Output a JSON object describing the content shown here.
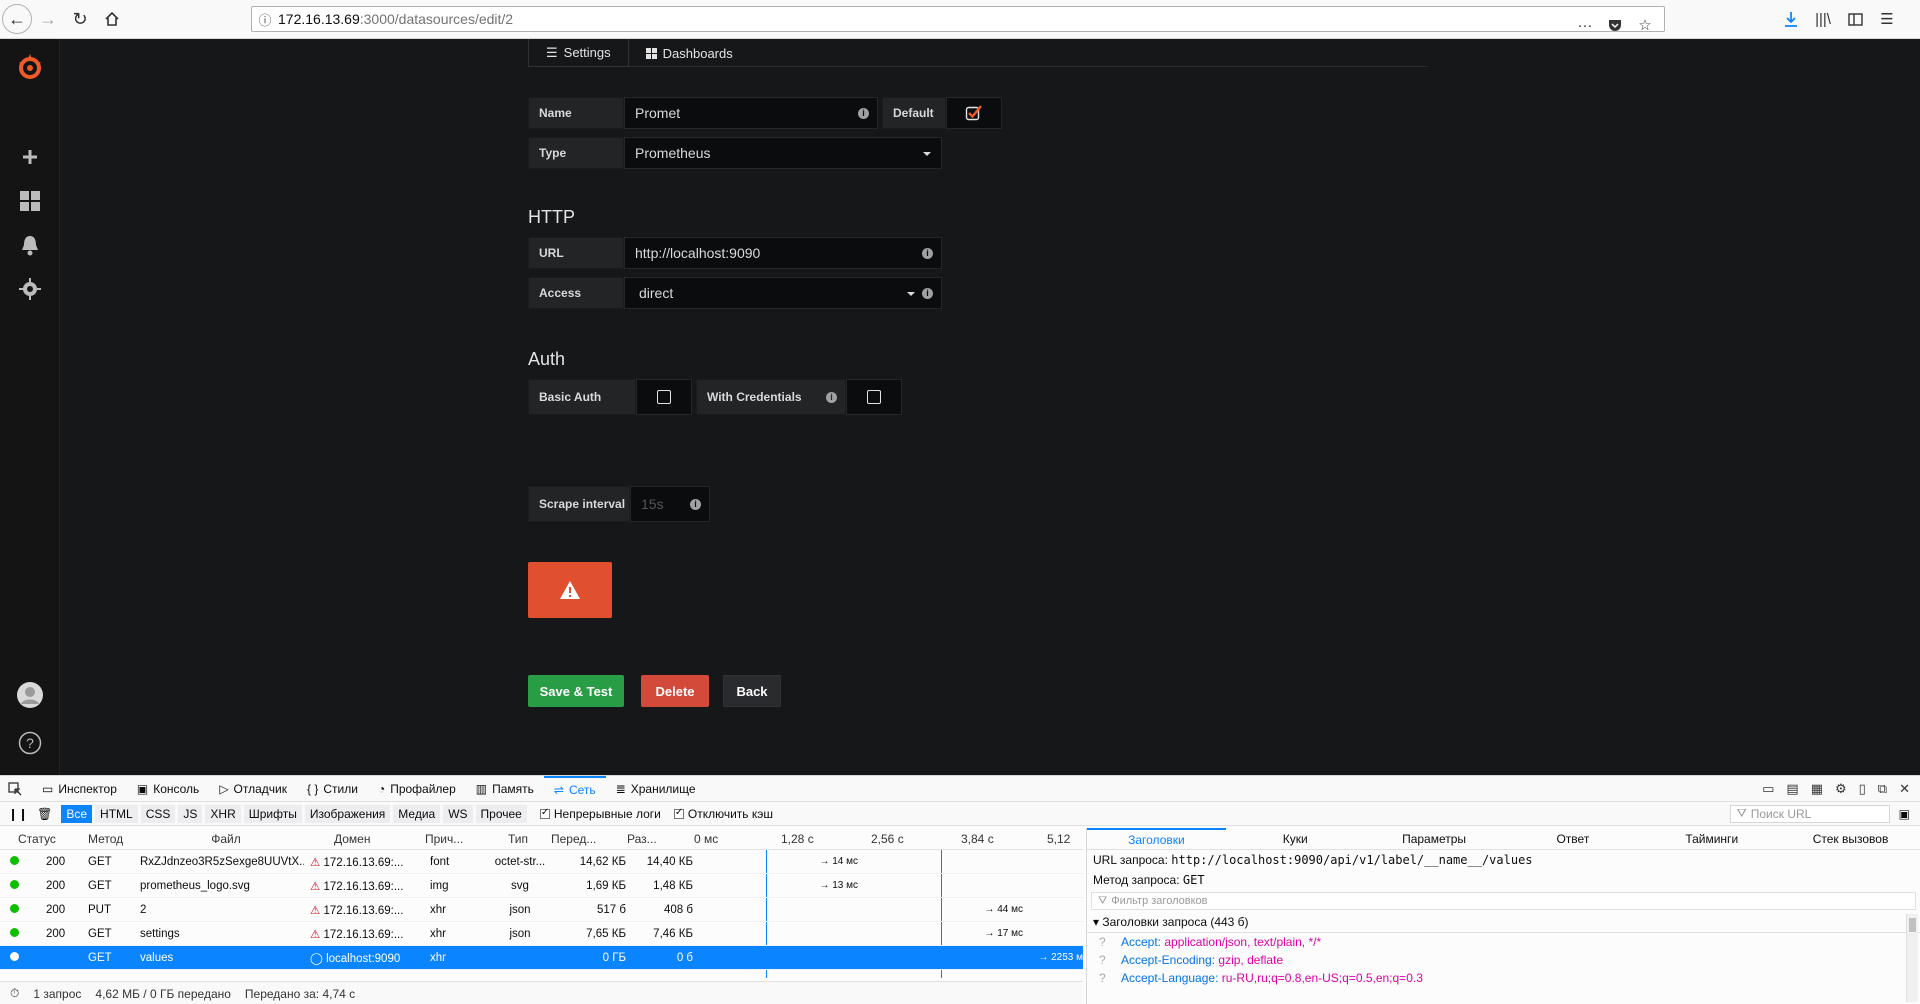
{
  "browser": {
    "url_host": "172.16.13.69",
    "url_path": ":3000/datasources/edit/2"
  },
  "tabs": [
    {
      "label": "Settings"
    },
    {
      "label": "Dashboards"
    }
  ],
  "form": {
    "name_label": "Name",
    "name_value": "Promet",
    "default_label": "Default",
    "type_label": "Type",
    "type_value": "Prometheus",
    "http_title": "HTTP",
    "url_label": "URL",
    "url_value": "http://localhost:9090",
    "access_label": "Access",
    "access_value": "direct",
    "auth_title": "Auth",
    "basic_auth_label": "Basic Auth",
    "with_credentials_label": "With Credentials",
    "scrape_label": "Scrape interval",
    "scrape_placeholder": "15s"
  },
  "buttons": {
    "save": "Save & Test",
    "delete": "Delete",
    "back": "Back"
  },
  "colors": {
    "save": "#299c46",
    "delete": "#d44a3a",
    "alert": "#e0502e",
    "grafana_orange": "#f05a28"
  },
  "devtools": {
    "tabs": [
      "Инспектор",
      "Консоль",
      "Отладчик",
      "Стили",
      "Профайлер",
      "Память",
      "Сеть",
      "Хранилище"
    ],
    "filters": [
      "Все",
      "HTML",
      "CSS",
      "JS",
      "XHR",
      "Шрифты",
      "Изображения",
      "Медиа",
      "WS",
      "Прочее"
    ],
    "persist_logs": "Непрерывные логи",
    "disable_cache": "Отключить кэш",
    "search_placeholder": "Поиск URL",
    "columns": [
      "Статус",
      "Метод",
      "Файл",
      "Домен",
      "Прич...",
      "Тип",
      "Перед...",
      "Раз...",
      "0 мс",
      "1,28 с",
      "2,56 с",
      "3,84 с",
      "5,12"
    ],
    "rows": [
      {
        "status": "200",
        "method": "GET",
        "file": "RxZJdnzeo3R5zSexge8UUVtX...",
        "domain": "172.16.13.69:...",
        "cause": "font",
        "type": "octet-str...",
        "transferred": "14,62 КБ",
        "size": "14,40 КБ",
        "timing": "→ 14 мс"
      },
      {
        "status": "200",
        "method": "GET",
        "file": "prometheus_logo.svg",
        "domain": "172.16.13.69:...",
        "cause": "img",
        "type": "svg",
        "transferred": "1,69 КБ",
        "size": "1,48 КБ",
        "timing": "→ 13 мс"
      },
      {
        "status": "200",
        "method": "PUT",
        "file": "2",
        "domain": "172.16.13.69:...",
        "cause": "xhr",
        "type": "json",
        "transferred": "517 б",
        "size": "408 б",
        "timing": "→ 44 мс"
      },
      {
        "status": "200",
        "method": "GET",
        "file": "settings",
        "domain": "172.16.13.69:...",
        "cause": "xhr",
        "type": "json",
        "transferred": "7,65 КБ",
        "size": "7,46 КБ",
        "timing": "→ 17 мс"
      },
      {
        "status": "",
        "method": "GET",
        "file": "values",
        "domain": "localhost:9090",
        "cause": "xhr",
        "type": "",
        "transferred": "0 ГБ",
        "size": "0 б",
        "timing": "→ 2253 м"
      }
    ],
    "status_requests": "1 запрос",
    "status_size": "4,62 МБ / 0 ГБ передано",
    "status_time": "Передано за: 4,74 с",
    "side_tabs": [
      "Заголовки",
      "Куки",
      "Параметры",
      "Ответ",
      "Тайминги",
      "Стек вызовов"
    ],
    "request_url_label": "URL запроса:",
    "request_url": "http://localhost:9090/api/v1/label/__name__/values",
    "method_label": "Метод запроса:",
    "method_value": "GET",
    "header_filter_placeholder": "Фильтр заголовков",
    "request_headers_title": "Заголовки запроса (443 б)",
    "headers": [
      {
        "key": "Accept:",
        "value": "application/json, text/plain, */*"
      },
      {
        "key": "Accept-Encoding:",
        "value": "gzip, deflate"
      },
      {
        "key": "Accept-Language:",
        "value": "ru-RU,ru;q=0.8,en-US;q=0.5,en;q=0.3"
      }
    ]
  }
}
